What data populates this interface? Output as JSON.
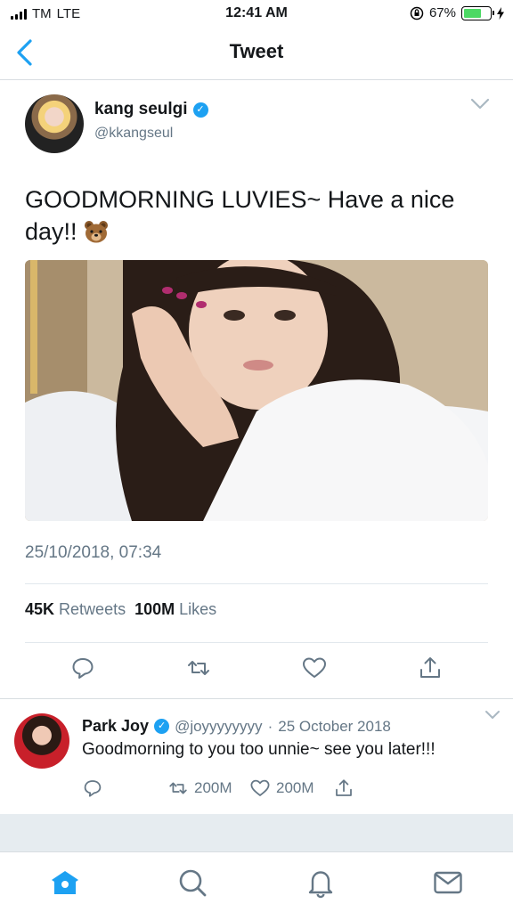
{
  "status_bar": {
    "carrier": "TM",
    "network": "LTE",
    "time": "12:41 AM",
    "battery": "67%",
    "battery_level": 0.67
  },
  "nav": {
    "title": "Tweet"
  },
  "tweet": {
    "author_name": "kang seulgi",
    "handle": "@kkangseul",
    "text": "GOODMORNING LUVIES~ Have a nice day!!",
    "emoji": "bear-face",
    "timestamp": "25/10/2018, 07:34",
    "retweets_count": "45K",
    "retweets_label": "Retweets",
    "likes_count": "100M",
    "likes_label": "Likes"
  },
  "reply": {
    "author_name": "Park Joy",
    "handle": "@joyyyyyyyy",
    "separator": "·",
    "date": "25 October 2018",
    "text": "Goodmorning to you too unnie~ see you later!!!",
    "retweets_count": "200M",
    "likes_count": "200M"
  },
  "icons": {
    "back": "chevron-left-icon",
    "reply": "reply-icon",
    "retweet": "retweet-icon",
    "like": "heart-icon",
    "share": "share-icon",
    "tabs": [
      "home-icon",
      "search-icon",
      "notifications-icon",
      "messages-icon"
    ]
  },
  "colors": {
    "accent": "#1da1f2",
    "secondary_text": "#657786",
    "verified_badge": "#1da1f2"
  }
}
